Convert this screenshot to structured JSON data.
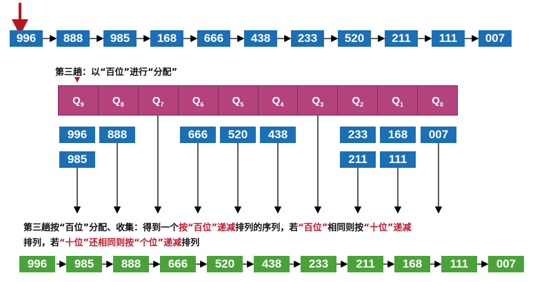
{
  "top_row": [
    "996",
    "888",
    "985",
    "168",
    "666",
    "438",
    "233",
    "520",
    "211",
    "111",
    "007"
  ],
  "pass_label": "第三趟：以“百位”进行“分配”",
  "queues": [
    {
      "name": "Q",
      "sub": "9",
      "items": [
        "996",
        "985"
      ]
    },
    {
      "name": "Q",
      "sub": "8",
      "items": [
        "888"
      ]
    },
    {
      "name": "Q",
      "sub": "7",
      "items": []
    },
    {
      "name": "Q",
      "sub": "6",
      "items": [
        "666"
      ]
    },
    {
      "name": "Q",
      "sub": "5",
      "items": [
        "520"
      ]
    },
    {
      "name": "Q",
      "sub": "4",
      "items": [
        "438"
      ]
    },
    {
      "name": "Q",
      "sub": "3",
      "items": []
    },
    {
      "name": "Q",
      "sub": "2",
      "items": [
        "233",
        "211"
      ]
    },
    {
      "name": "Q",
      "sub": "1",
      "items": [
        "168",
        "111"
      ]
    },
    {
      "name": "Q",
      "sub": "0",
      "items": [
        "007"
      ]
    }
  ],
  "caption": {
    "l1a": "第三趟按“百位”分配、收集：得到一个",
    "l1b": "按“百位”递减",
    "l1c": "排列的序列，若",
    "l1d": "“百位”",
    "l1e": "相同则按",
    "l1f": "“十位”递减",
    "l2a": "排列，若",
    "l2b": "“十位”还相同则按“个位”递减",
    "l2c": "排列"
  },
  "result_row": [
    "996",
    "985",
    "888",
    "666",
    "520",
    "438",
    "233",
    "211",
    "168",
    "111",
    "007"
  ],
  "colors": {
    "blue": "#1a6fb6",
    "green": "#4aa338",
    "queue": "#b3437a",
    "accent": "#c0192b"
  }
}
